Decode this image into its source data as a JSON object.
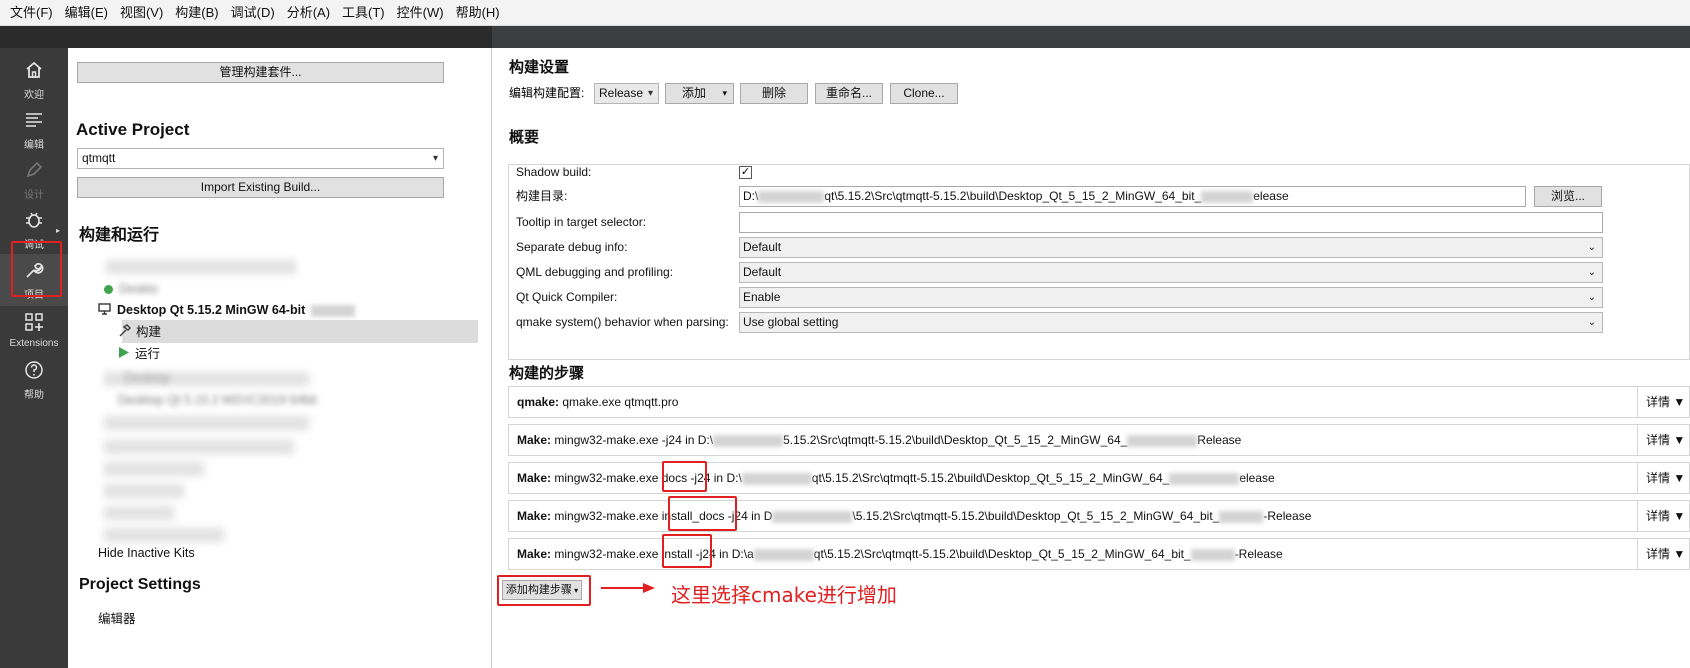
{
  "menu": [
    "文件(F)",
    "编辑(E)",
    "视图(V)",
    "构建(B)",
    "调试(D)",
    "分析(A)",
    "工具(T)",
    "控件(W)",
    "帮助(H)"
  ],
  "modes": [
    {
      "label": "欢迎",
      "icon": "home-icon"
    },
    {
      "label": "编辑",
      "icon": "edit-lines-icon"
    },
    {
      "label": "设计",
      "icon": "pen-icon"
    },
    {
      "label": "调试",
      "icon": "bug-icon"
    },
    {
      "label": "项目",
      "icon": "wrench-icon"
    },
    {
      "label": "Extensions",
      "icon": "extensions-icon"
    },
    {
      "label": "帮助",
      "icon": "help-icon"
    }
  ],
  "left": {
    "manage_kits": "管理构建套件...",
    "active_project_title": "Active Project",
    "project_name": "qtmqtt",
    "import_build": "Import Existing Build...",
    "build_run_title": "构建和运行",
    "kit_partial": "Deskto",
    "kit_name": "Desktop Qt 5.15.2 MinGW 64-bit",
    "build_item": "构建",
    "run_item": "运行",
    "inactive_kit_1": "Desktop",
    "inactive_kit_2": "Desktop Qt 5.15.2 MSVC2019 64bit",
    "hide_inactive": "Hide Inactive Kits",
    "project_settings_title": "Project Settings",
    "editor_item": "编辑器"
  },
  "right": {
    "build_settings_title": "构建设置",
    "edit_config_label": "编辑构建配置:",
    "config_value": "Release",
    "add_button": "添加",
    "delete_button": "删除",
    "rename_button": "重命名...",
    "clone_button": "Clone...",
    "overview_title": "概要",
    "shadow_build_label": "Shadow build:",
    "shadow_build_checked": "✓",
    "build_dir_label": "构建目录:",
    "build_dir_prefix": "D:\\",
    "build_dir_mid": "qt\\5.15.2\\Src\\qtmqtt-5.15.2\\build\\Desktop_Qt_5_15_2_MinGW_64_bit_",
    "build_dir_suffix": "elease",
    "browse_button": "浏览...",
    "tooltip_label": "Tooltip in target selector:",
    "tooltip_value": "",
    "sep_debug_label": "Separate debug info:",
    "sep_debug_value": "Default",
    "qml_debug_label": "QML debugging and profiling:",
    "qml_debug_value": "Default",
    "quick_compiler_label": "Qt Quick Compiler:",
    "quick_compiler_value": "Enable",
    "qmake_behavior_label": "qmake system() behavior when parsing:",
    "qmake_behavior_value": "Use global setting",
    "build_steps_title": "构建的步骤",
    "details_label": "详情",
    "steps": [
      {
        "name": "qmake:",
        "a": "qmake.exe qtmqtt.pro",
        "b": "",
        "c": ""
      },
      {
        "name": "Make:",
        "a": "mingw32-make.exe -j24 in D:\\",
        "b": "5.15.2\\Src\\qtmqtt-5.15.2\\build\\Desktop_Qt_5_15_2_MinGW_64_",
        "c": "Release"
      },
      {
        "name": "Make:",
        "a": "mingw32-make.exe docs -j24 in D:\\",
        "b": "qt\\5.15.2\\Src\\qtmqtt-5.15.2\\build\\Desktop_Qt_5_15_2_MinGW_64_",
        "c": "elease"
      },
      {
        "name": "Make:",
        "a": "mingw32-make.exe install_docs -j24 in D",
        "b": "\\5.15.2\\Src\\qtmqtt-5.15.2\\build\\Desktop_Qt_5_15_2_MinGW_64_bit_",
        "c": "-Release"
      },
      {
        "name": "Make:",
        "a": "mingw32-make.exe install -j24 in D:\\a",
        "b": "qt\\5.15.2\\Src\\qtmqtt-5.15.2\\build\\Desktop_Qt_5_15_2_MinGW_64_bit_",
        "c": "-Release"
      }
    ],
    "add_step_button": "添加构建步骤",
    "annotation": "这里选择cmake进行增加"
  },
  "colors": {
    "highlight": "#e02020",
    "sidebar": "#3a3a3a"
  }
}
